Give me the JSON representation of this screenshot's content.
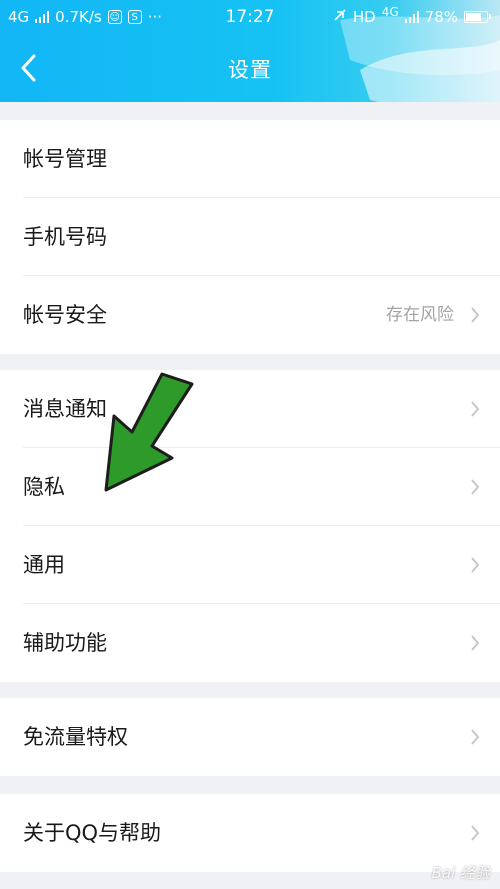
{
  "status_bar": {
    "network_left": "4G",
    "speed": "0.7K/s",
    "time": "17:27",
    "hd": "HD",
    "network_right": "4G",
    "battery_text": "78%",
    "battery_level": 0.78
  },
  "nav": {
    "title": "设置"
  },
  "groups": [
    {
      "items": [
        {
          "label": "帐号管理",
          "value": ""
        },
        {
          "label": "手机号码",
          "value": ""
        },
        {
          "label": "帐号安全",
          "value": "存在风险"
        }
      ]
    },
    {
      "items": [
        {
          "label": "消息通知"
        },
        {
          "label": "隐私"
        },
        {
          "label": "通用"
        },
        {
          "label": "辅助功能"
        }
      ]
    },
    {
      "items": [
        {
          "label": "免流量特权"
        }
      ]
    },
    {
      "items": [
        {
          "label": "关于QQ与帮助"
        }
      ]
    }
  ],
  "watermark": "Bai 经验",
  "colors": {
    "accent": "#12b6f5",
    "annotation_arrow": "#2e9a2a"
  }
}
